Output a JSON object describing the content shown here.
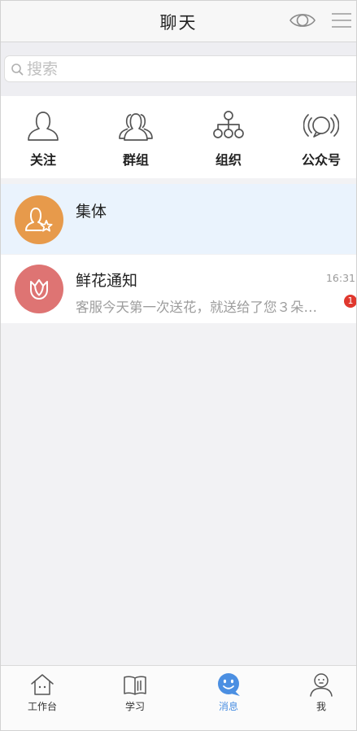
{
  "header": {
    "title": "聊天",
    "eye_icon": "eye-icon",
    "menu_icon": "menu-icon"
  },
  "search": {
    "placeholder": "搜索",
    "icon": "search-icon"
  },
  "categories": [
    {
      "label": "关注",
      "icon": "follow-person-icon"
    },
    {
      "label": "群组",
      "icon": "group-icon"
    },
    {
      "label": "组织",
      "icon": "org-chart-icon"
    },
    {
      "label": "公众号",
      "icon": "broadcast-icon"
    }
  ],
  "chats": [
    {
      "title": "集体",
      "icon": "person-star-icon",
      "avatar_color": "#e79a4b",
      "selected": true
    },
    {
      "title": "鲜花通知",
      "time": "16:31",
      "preview": "客服今天第一次送花，就送给了您３朵…",
      "unread": "1",
      "icon": "flower-icon",
      "avatar_color": "#de7473"
    }
  ],
  "tabbar": [
    {
      "label": "工作台",
      "icon": "workbench-icon"
    },
    {
      "label": "学习",
      "icon": "book-icon"
    },
    {
      "label": "消息",
      "icon": "message-icon",
      "active": true
    },
    {
      "label": "我",
      "icon": "profile-icon"
    }
  ],
  "colors": {
    "accent": "#4b8fe2",
    "selected_bg": "#eaf3fd",
    "badge": "#e0382e"
  }
}
